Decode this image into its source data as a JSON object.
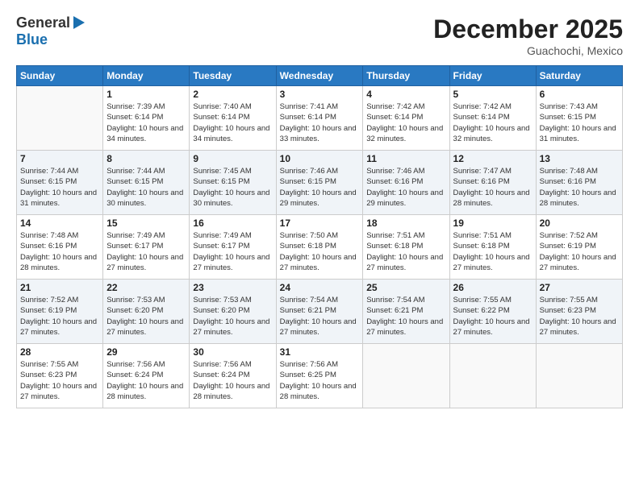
{
  "logo": {
    "general": "General",
    "blue": "Blue"
  },
  "title": "December 2025",
  "location": "Guachochi, Mexico",
  "days_header": [
    "Sunday",
    "Monday",
    "Tuesday",
    "Wednesday",
    "Thursday",
    "Friday",
    "Saturday"
  ],
  "weeks": [
    [
      {
        "num": "",
        "sunrise": "",
        "sunset": "",
        "daylight": ""
      },
      {
        "num": "1",
        "sunrise": "Sunrise: 7:39 AM",
        "sunset": "Sunset: 6:14 PM",
        "daylight": "Daylight: 10 hours and 34 minutes."
      },
      {
        "num": "2",
        "sunrise": "Sunrise: 7:40 AM",
        "sunset": "Sunset: 6:14 PM",
        "daylight": "Daylight: 10 hours and 34 minutes."
      },
      {
        "num": "3",
        "sunrise": "Sunrise: 7:41 AM",
        "sunset": "Sunset: 6:14 PM",
        "daylight": "Daylight: 10 hours and 33 minutes."
      },
      {
        "num": "4",
        "sunrise": "Sunrise: 7:42 AM",
        "sunset": "Sunset: 6:14 PM",
        "daylight": "Daylight: 10 hours and 32 minutes."
      },
      {
        "num": "5",
        "sunrise": "Sunrise: 7:42 AM",
        "sunset": "Sunset: 6:14 PM",
        "daylight": "Daylight: 10 hours and 32 minutes."
      },
      {
        "num": "6",
        "sunrise": "Sunrise: 7:43 AM",
        "sunset": "Sunset: 6:15 PM",
        "daylight": "Daylight: 10 hours and 31 minutes."
      }
    ],
    [
      {
        "num": "7",
        "sunrise": "Sunrise: 7:44 AM",
        "sunset": "Sunset: 6:15 PM",
        "daylight": "Daylight: 10 hours and 31 minutes."
      },
      {
        "num": "8",
        "sunrise": "Sunrise: 7:44 AM",
        "sunset": "Sunset: 6:15 PM",
        "daylight": "Daylight: 10 hours and 30 minutes."
      },
      {
        "num": "9",
        "sunrise": "Sunrise: 7:45 AM",
        "sunset": "Sunset: 6:15 PM",
        "daylight": "Daylight: 10 hours and 30 minutes."
      },
      {
        "num": "10",
        "sunrise": "Sunrise: 7:46 AM",
        "sunset": "Sunset: 6:15 PM",
        "daylight": "Daylight: 10 hours and 29 minutes."
      },
      {
        "num": "11",
        "sunrise": "Sunrise: 7:46 AM",
        "sunset": "Sunset: 6:16 PM",
        "daylight": "Daylight: 10 hours and 29 minutes."
      },
      {
        "num": "12",
        "sunrise": "Sunrise: 7:47 AM",
        "sunset": "Sunset: 6:16 PM",
        "daylight": "Daylight: 10 hours and 28 minutes."
      },
      {
        "num": "13",
        "sunrise": "Sunrise: 7:48 AM",
        "sunset": "Sunset: 6:16 PM",
        "daylight": "Daylight: 10 hours and 28 minutes."
      }
    ],
    [
      {
        "num": "14",
        "sunrise": "Sunrise: 7:48 AM",
        "sunset": "Sunset: 6:16 PM",
        "daylight": "Daylight: 10 hours and 28 minutes."
      },
      {
        "num": "15",
        "sunrise": "Sunrise: 7:49 AM",
        "sunset": "Sunset: 6:17 PM",
        "daylight": "Daylight: 10 hours and 27 minutes."
      },
      {
        "num": "16",
        "sunrise": "Sunrise: 7:49 AM",
        "sunset": "Sunset: 6:17 PM",
        "daylight": "Daylight: 10 hours and 27 minutes."
      },
      {
        "num": "17",
        "sunrise": "Sunrise: 7:50 AM",
        "sunset": "Sunset: 6:18 PM",
        "daylight": "Daylight: 10 hours and 27 minutes."
      },
      {
        "num": "18",
        "sunrise": "Sunrise: 7:51 AM",
        "sunset": "Sunset: 6:18 PM",
        "daylight": "Daylight: 10 hours and 27 minutes."
      },
      {
        "num": "19",
        "sunrise": "Sunrise: 7:51 AM",
        "sunset": "Sunset: 6:18 PM",
        "daylight": "Daylight: 10 hours and 27 minutes."
      },
      {
        "num": "20",
        "sunrise": "Sunrise: 7:52 AM",
        "sunset": "Sunset: 6:19 PM",
        "daylight": "Daylight: 10 hours and 27 minutes."
      }
    ],
    [
      {
        "num": "21",
        "sunrise": "Sunrise: 7:52 AM",
        "sunset": "Sunset: 6:19 PM",
        "daylight": "Daylight: 10 hours and 27 minutes."
      },
      {
        "num": "22",
        "sunrise": "Sunrise: 7:53 AM",
        "sunset": "Sunset: 6:20 PM",
        "daylight": "Daylight: 10 hours and 27 minutes."
      },
      {
        "num": "23",
        "sunrise": "Sunrise: 7:53 AM",
        "sunset": "Sunset: 6:20 PM",
        "daylight": "Daylight: 10 hours and 27 minutes."
      },
      {
        "num": "24",
        "sunrise": "Sunrise: 7:54 AM",
        "sunset": "Sunset: 6:21 PM",
        "daylight": "Daylight: 10 hours and 27 minutes."
      },
      {
        "num": "25",
        "sunrise": "Sunrise: 7:54 AM",
        "sunset": "Sunset: 6:21 PM",
        "daylight": "Daylight: 10 hours and 27 minutes."
      },
      {
        "num": "26",
        "sunrise": "Sunrise: 7:55 AM",
        "sunset": "Sunset: 6:22 PM",
        "daylight": "Daylight: 10 hours and 27 minutes."
      },
      {
        "num": "27",
        "sunrise": "Sunrise: 7:55 AM",
        "sunset": "Sunset: 6:23 PM",
        "daylight": "Daylight: 10 hours and 27 minutes."
      }
    ],
    [
      {
        "num": "28",
        "sunrise": "Sunrise: 7:55 AM",
        "sunset": "Sunset: 6:23 PM",
        "daylight": "Daylight: 10 hours and 27 minutes."
      },
      {
        "num": "29",
        "sunrise": "Sunrise: 7:56 AM",
        "sunset": "Sunset: 6:24 PM",
        "daylight": "Daylight: 10 hours and 28 minutes."
      },
      {
        "num": "30",
        "sunrise": "Sunrise: 7:56 AM",
        "sunset": "Sunset: 6:24 PM",
        "daylight": "Daylight: 10 hours and 28 minutes."
      },
      {
        "num": "31",
        "sunrise": "Sunrise: 7:56 AM",
        "sunset": "Sunset: 6:25 PM",
        "daylight": "Daylight: 10 hours and 28 minutes."
      },
      {
        "num": "",
        "sunrise": "",
        "sunset": "",
        "daylight": ""
      },
      {
        "num": "",
        "sunrise": "",
        "sunset": "",
        "daylight": ""
      },
      {
        "num": "",
        "sunrise": "",
        "sunset": "",
        "daylight": ""
      }
    ]
  ]
}
